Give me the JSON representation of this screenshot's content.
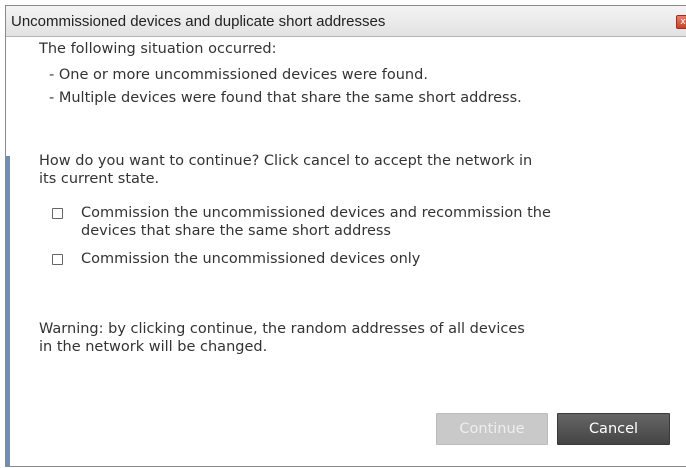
{
  "dialog": {
    "title": "Uncommissioned devices and duplicate short addresses",
    "close_icon_glyph": "x",
    "intro": "The following situation occurred:",
    "issues": [
      "- One or more uncommissioned devices were found.",
      "- Multiple devices were found that share the same short address."
    ],
    "question_line1": "How do you want to continue? Click cancel to accept the network in",
    "question_line2": "its current state.",
    "options": [
      {
        "label_line1": "Commission the uncommissioned devices and recommission the",
        "label_line2": "devices that share the same short address",
        "checked": false
      },
      {
        "label_line1": "Commission the uncommissioned devices only",
        "checked": false
      }
    ],
    "warning_line1": "Warning: by clicking continue, the random addresses of all devices",
    "warning_line2": "in the network will be changed.",
    "buttons": {
      "continue_label": "Continue",
      "continue_enabled": false,
      "cancel_label": "Cancel"
    }
  },
  "colors": {
    "close_button": "#d0533b",
    "cancel_button": "#555555",
    "continue_disabled": "#c9c9c9",
    "accent_bar": "#6f8fb5"
  }
}
